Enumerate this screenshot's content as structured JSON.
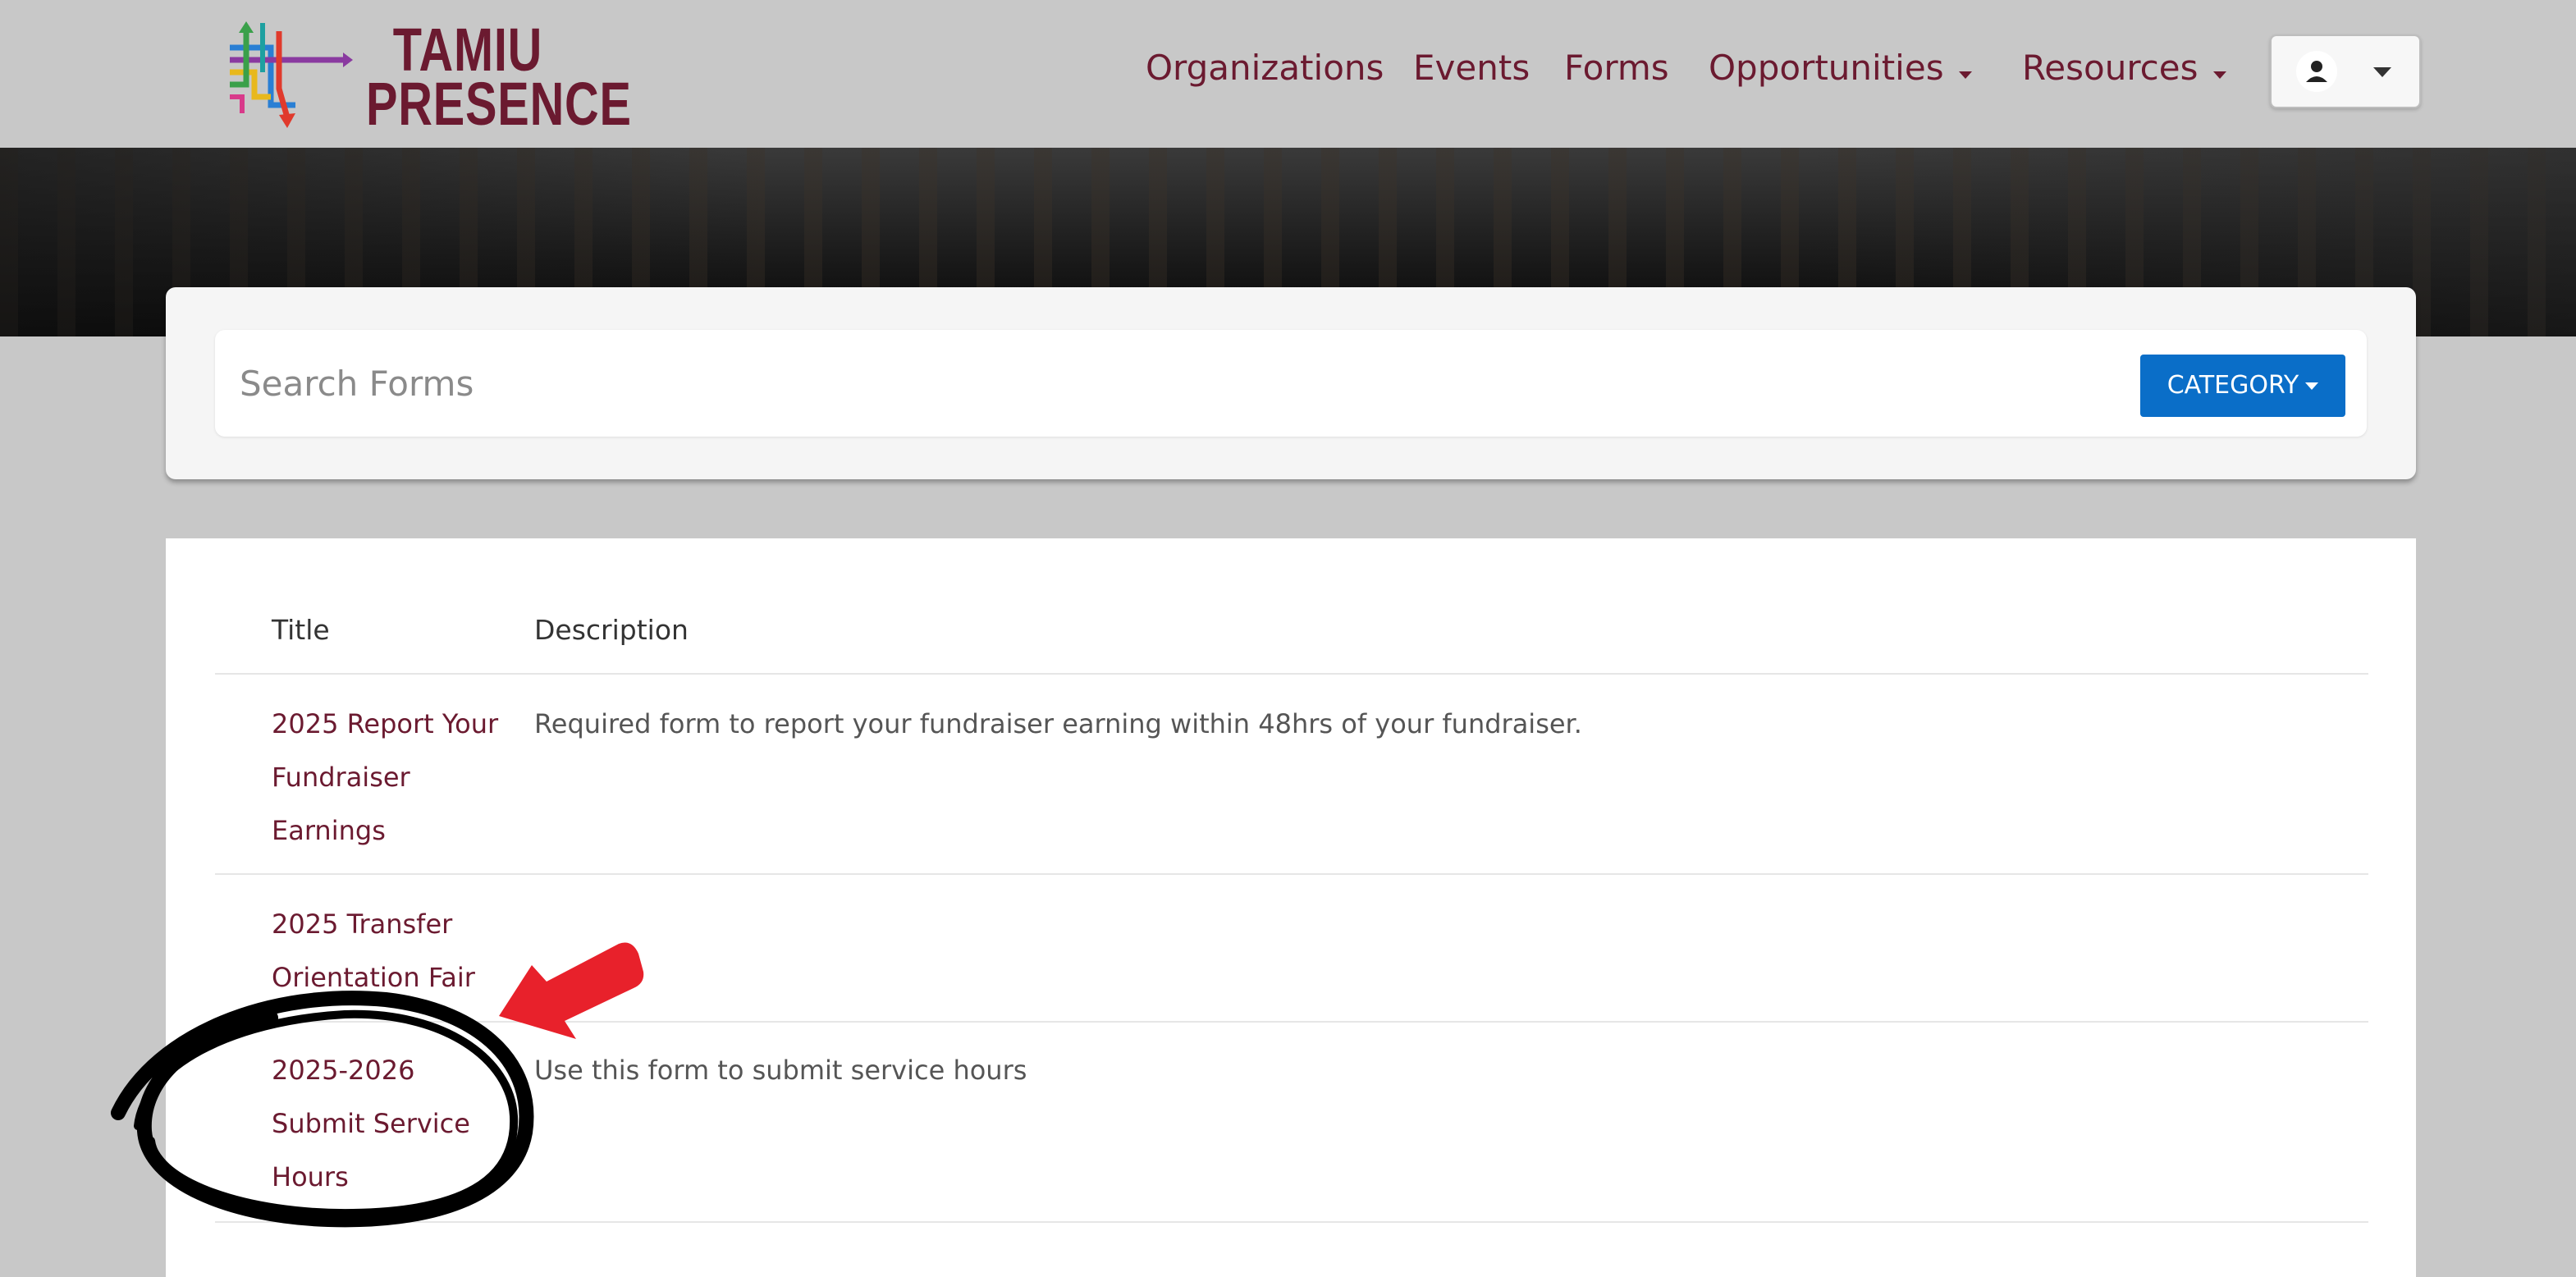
{
  "header": {
    "logo": {
      "line1": "TAMIU",
      "line2": "PRESENCE",
      "brand_color": "#6b1a30"
    },
    "nav": [
      {
        "label": "Organizations",
        "has_dropdown": false
      },
      {
        "label": "Events",
        "has_dropdown": false
      },
      {
        "label": "Forms",
        "has_dropdown": false
      },
      {
        "label": "Opportunities",
        "has_dropdown": true
      },
      {
        "label": "Resources",
        "has_dropdown": true
      }
    ],
    "user_menu": {
      "icon": "user-avatar-icon"
    }
  },
  "search": {
    "placeholder": "Search Forms",
    "value": "",
    "category_label": "CATEGORY",
    "button_color": "#0a6ec8"
  },
  "table": {
    "columns": [
      "Title",
      "Description"
    ],
    "rows": [
      {
        "title_lines": [
          "2025 Report Your",
          "Fundraiser",
          "Earnings"
        ],
        "description": "Required form to report your fundraiser earning within 48hrs of your fundraiser."
      },
      {
        "title_lines": [
          "2025 Transfer",
          "Orientation Fair"
        ],
        "description": ""
      },
      {
        "title_lines": [
          "2025-2026",
          "Submit Service",
          "Hours"
        ],
        "description": "Use this form to submit service hours"
      }
    ]
  },
  "annotations": {
    "arrow_color": "#e8212b",
    "circle_color": "#000000"
  }
}
